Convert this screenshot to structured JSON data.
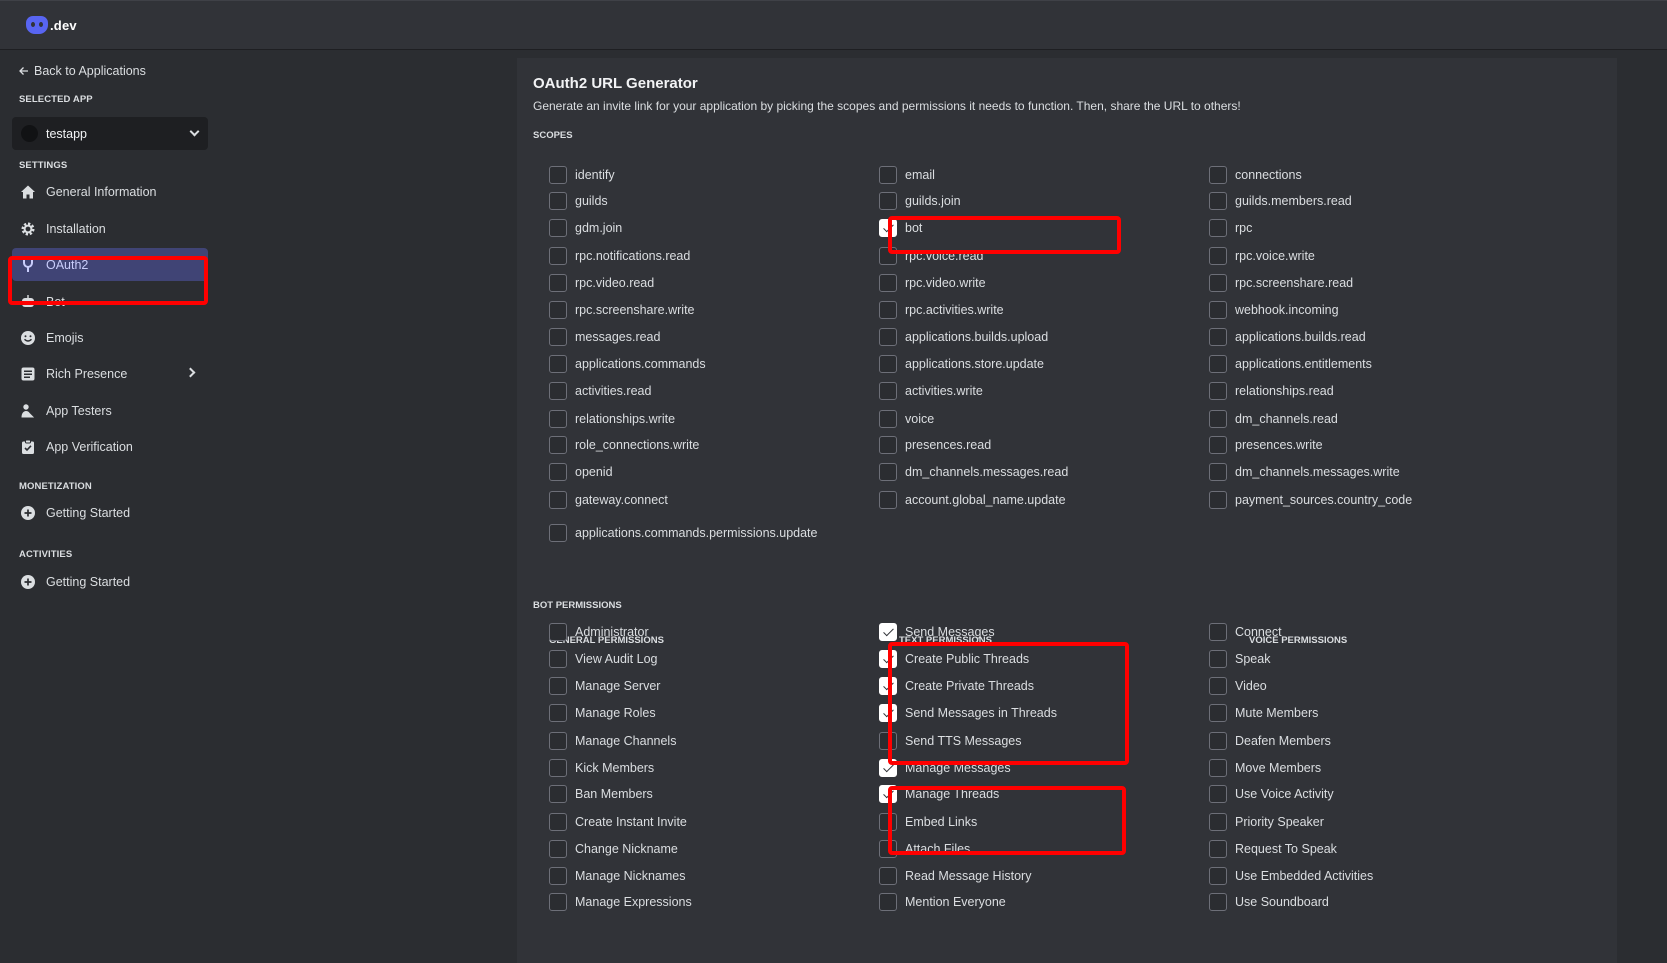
{
  "brand": {
    "text": ".dev"
  },
  "sidebar": {
    "back_label": "Back to Applications",
    "selected_app_heading": "SELECTED APP",
    "app_name": "testapp",
    "settings_heading": "SETTINGS",
    "items": [
      {
        "label": "General Information",
        "icon": "home-icon"
      },
      {
        "label": "Installation",
        "icon": "gear-icon"
      },
      {
        "label": "OAuth2",
        "icon": "wrench-icon"
      },
      {
        "label": "Bot",
        "icon": "robot-icon"
      },
      {
        "label": "Emojis",
        "icon": "smile-icon"
      },
      {
        "label": "Rich Presence",
        "icon": "list-icon"
      },
      {
        "label": "App Testers",
        "icon": "person-icon"
      },
      {
        "label": "App Verification",
        "icon": "clipboard-check-icon"
      }
    ],
    "monetization_heading": "MONETIZATION",
    "monetization_item": "Getting Started",
    "activities_heading": "ACTIVITIES",
    "activities_item": "Getting Started"
  },
  "main": {
    "title": "OAuth2 URL Generator",
    "description": "Generate an invite link for your application by picking the scopes and permissions it needs to function. Then, share the URL to others!",
    "scopes_heading": "SCOPES",
    "scopes": [
      [
        {
          "label": "identify",
          "checked": false
        },
        {
          "label": "email",
          "checked": false
        },
        {
          "label": "connections",
          "checked": false
        }
      ],
      [
        {
          "label": "guilds",
          "checked": false
        },
        {
          "label": "guilds.join",
          "checked": false
        },
        {
          "label": "guilds.members.read",
          "checked": false
        }
      ],
      [
        {
          "label": "gdm.join",
          "checked": false
        },
        {
          "label": "bot",
          "checked": true
        },
        {
          "label": "rpc",
          "checked": false
        }
      ],
      [
        {
          "label": "rpc.notifications.read",
          "checked": false
        },
        {
          "label": "rpc.voice.read",
          "checked": false
        },
        {
          "label": "rpc.voice.write",
          "checked": false
        }
      ],
      [
        {
          "label": "rpc.video.read",
          "checked": false
        },
        {
          "label": "rpc.video.write",
          "checked": false
        },
        {
          "label": "rpc.screenshare.read",
          "checked": false
        }
      ],
      [
        {
          "label": "rpc.screenshare.write",
          "checked": false
        },
        {
          "label": "rpc.activities.write",
          "checked": false
        },
        {
          "label": "webhook.incoming",
          "checked": false
        }
      ],
      [
        {
          "label": "messages.read",
          "checked": false
        },
        {
          "label": "applications.builds.upload",
          "checked": false
        },
        {
          "label": "applications.builds.read",
          "checked": false
        }
      ],
      [
        {
          "label": "applications.commands",
          "checked": false
        },
        {
          "label": "applications.store.update",
          "checked": false
        },
        {
          "label": "applications.entitlements",
          "checked": false
        }
      ],
      [
        {
          "label": "activities.read",
          "checked": false
        },
        {
          "label": "activities.write",
          "checked": false
        },
        {
          "label": "relationships.read",
          "checked": false
        }
      ],
      [
        {
          "label": "relationships.write",
          "checked": false
        },
        {
          "label": "voice",
          "checked": false
        },
        {
          "label": "dm_channels.read",
          "checked": false
        }
      ],
      [
        {
          "label": "role_connections.write",
          "checked": false
        },
        {
          "label": "presences.read",
          "checked": false
        },
        {
          "label": "presences.write",
          "checked": false
        }
      ],
      [
        {
          "label": "openid",
          "checked": false
        },
        {
          "label": "dm_channels.messages.read",
          "checked": false
        },
        {
          "label": "dm_channels.messages.write",
          "checked": false
        }
      ],
      [
        {
          "label": "gateway.connect",
          "checked": false
        },
        {
          "label": "account.global_name.update",
          "checked": false
        },
        {
          "label": "payment_sources.country_code",
          "checked": false
        }
      ]
    ],
    "scopes_last": {
      "label": "applications.commands.permissions.update",
      "checked": false
    },
    "bot_permissions_heading": "BOT PERMISSIONS",
    "general_heading": "GENERAL PERMISSIONS",
    "text_heading": "TEXT PERMISSIONS",
    "voice_heading": "VOICE PERMISSIONS",
    "general_permissions": [
      {
        "label": "Administrator",
        "checked": false
      },
      {
        "label": "View Audit Log",
        "checked": false
      },
      {
        "label": "Manage Server",
        "checked": false
      },
      {
        "label": "Manage Roles",
        "checked": false
      },
      {
        "label": "Manage Channels",
        "checked": false
      },
      {
        "label": "Kick Members",
        "checked": false
      },
      {
        "label": "Ban Members",
        "checked": false
      },
      {
        "label": "Create Instant Invite",
        "checked": false
      },
      {
        "label": "Change Nickname",
        "checked": false
      },
      {
        "label": "Manage Nicknames",
        "checked": false
      },
      {
        "label": "Manage Expressions",
        "checked": false
      }
    ],
    "text_permissions": [
      {
        "label": "Send Messages",
        "checked": true
      },
      {
        "label": "Create Public Threads",
        "checked": true
      },
      {
        "label": "Create Private Threads",
        "checked": true
      },
      {
        "label": "Send Messages in Threads",
        "checked": true
      },
      {
        "label": "Send TTS Messages",
        "checked": false
      },
      {
        "label": "Manage Messages",
        "checked": true
      },
      {
        "label": "Manage Threads",
        "checked": true
      },
      {
        "label": "Embed Links",
        "checked": false
      },
      {
        "label": "Attach Files",
        "checked": false
      },
      {
        "label": "Read Message History",
        "checked": false
      },
      {
        "label": "Mention Everyone",
        "checked": false
      }
    ],
    "voice_permissions": [
      {
        "label": "Connect",
        "checked": false
      },
      {
        "label": "Speak",
        "checked": false
      },
      {
        "label": "Video",
        "checked": false
      },
      {
        "label": "Mute Members",
        "checked": false
      },
      {
        "label": "Deafen Members",
        "checked": false
      },
      {
        "label": "Move Members",
        "checked": false
      },
      {
        "label": "Use Voice Activity",
        "checked": false
      },
      {
        "label": "Priority Speaker",
        "checked": false
      },
      {
        "label": "Request To Speak",
        "checked": false
      },
      {
        "label": "Use Embedded Activities",
        "checked": false
      },
      {
        "label": "Use Soundboard",
        "checked": false
      }
    ]
  },
  "colors": {
    "highlight": "#ff0000",
    "active_nav": "#404475",
    "accent": "#5865f2"
  }
}
